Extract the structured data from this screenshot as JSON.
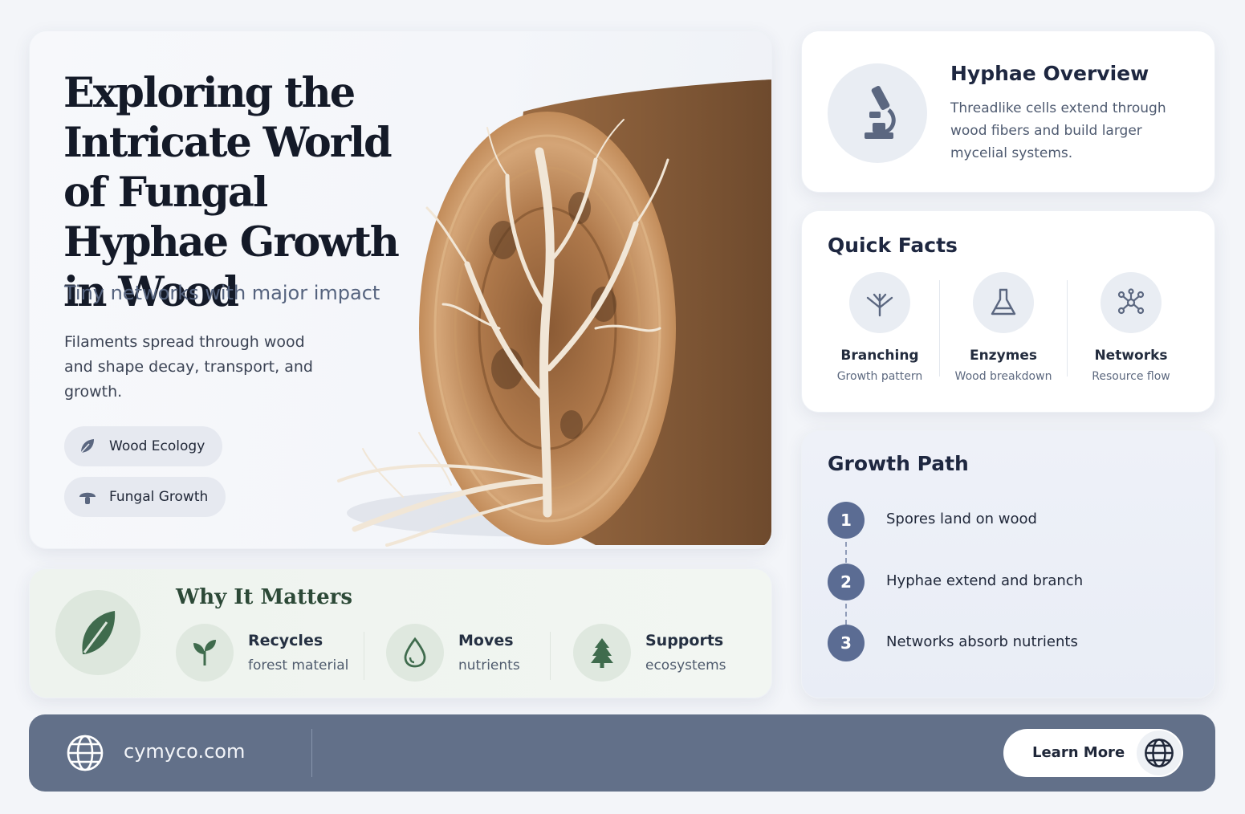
{
  "hero": {
    "title": "Exploring the Intricate World of Fungal Hyphae Growth in Wood",
    "subtitle": "Tiny networks with major impact",
    "description": "Filaments spread through wood and shape decay, transport, and growth.",
    "tags": [
      {
        "label": "Wood Ecology",
        "icon": "leaf-icon"
      },
      {
        "label": "Fungal Growth",
        "icon": "mushroom-icon"
      }
    ]
  },
  "overview": {
    "title": "Hyphae Overview",
    "text": "Threadlike cells extend through wood fibers and build larger mycelial systems.",
    "icon": "microscope-icon"
  },
  "facts": {
    "title": "Quick Facts",
    "items": [
      {
        "label": "Branching",
        "sub": "Growth pattern",
        "icon": "branching-icon"
      },
      {
        "label": "Enzymes",
        "sub": "Wood breakdown",
        "icon": "flask-icon"
      },
      {
        "label": "Networks",
        "sub": "Resource flow",
        "icon": "network-icon"
      }
    ]
  },
  "growth": {
    "title": "Growth Path",
    "steps": [
      {
        "num": "1",
        "text": "Spores land on wood"
      },
      {
        "num": "2",
        "text": "Hyphae extend and branch"
      },
      {
        "num": "3",
        "text": "Networks absorb nutrients"
      }
    ]
  },
  "why": {
    "title": "Why It Matters",
    "items": [
      {
        "label": "Recycles",
        "sub": "forest material",
        "icon": "sprout-icon"
      },
      {
        "label": "Moves",
        "sub": "nutrients",
        "icon": "water-drop-icon"
      },
      {
        "label": "Supports",
        "sub": "ecosystems",
        "icon": "tree-icon"
      }
    ]
  },
  "footer": {
    "site": "cymyco.com",
    "button_label": "Learn More"
  },
  "colors": {
    "accent": "#5b6c93",
    "footer_bg": "#627089",
    "green": "#3f6b4d"
  }
}
